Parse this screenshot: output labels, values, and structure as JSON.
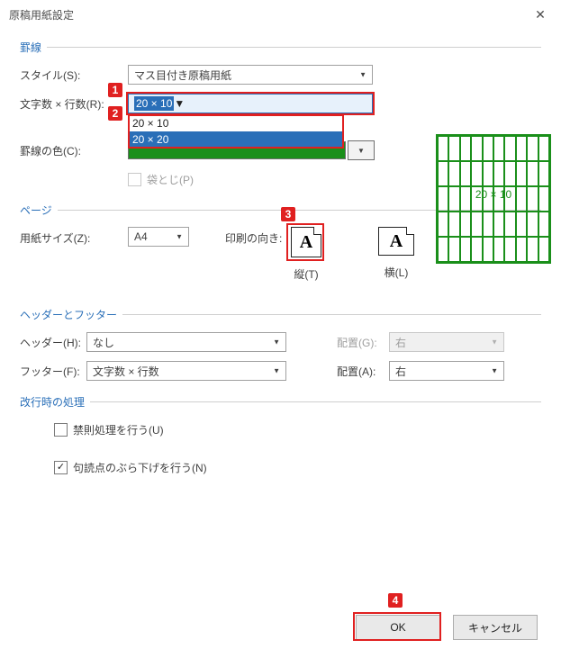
{
  "title": "原稿用紙設定",
  "groups": {
    "lines": "罫線",
    "page": "ページ",
    "hf": "ヘッダーとフッター",
    "wrap": "改行時の処理"
  },
  "labels": {
    "style": "スタイル(S):",
    "grid": "文字数 × 行数(R):",
    "line_color": "罫線の色(C):",
    "bookfold": "袋とじ(P)",
    "paper_size": "用紙サイズ(Z):",
    "print_orient": "印刷の向き:",
    "orient_v": "縦(T)",
    "orient_h": "横(L)",
    "header": "ヘッダー(H):",
    "footer": "フッター(F):",
    "align_g": "配置(G):",
    "align_a": "配置(A):",
    "kinsoku": "禁則処理を行う(U)",
    "burasage": "句読点のぶら下げを行う(N)"
  },
  "values": {
    "style": "マス目付き原稿用紙",
    "grid_selected": "20 × 10",
    "grid_opt1": "20 × 10",
    "grid_opt2": "20 × 20",
    "paper_size": "A4",
    "header": "なし",
    "footer": "文字数 × 行数",
    "align_g": "右",
    "align_a": "右",
    "grid_preview": "20 × 10"
  },
  "markers": {
    "m1": "1",
    "m2": "2",
    "m3": "3",
    "m4": "4"
  },
  "buttons": {
    "ok": "OK",
    "cancel": "キャンセル"
  }
}
